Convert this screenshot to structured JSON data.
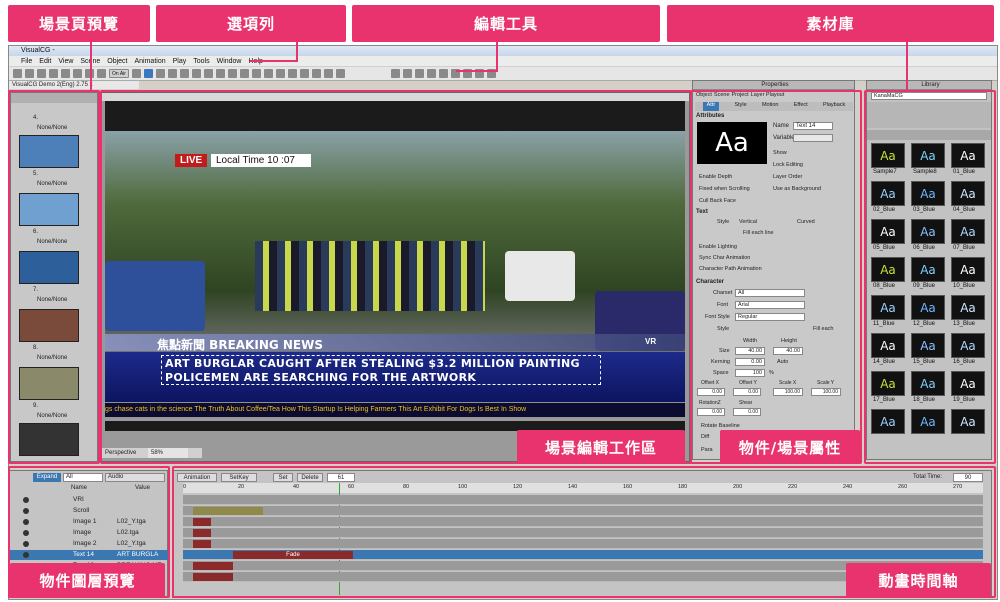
{
  "window": {
    "title": "VisualCG -",
    "doc_tab": "VisualCG Demo 2(Eng) 2.75 x"
  },
  "menu": [
    "File",
    "Edit",
    "View",
    "Scene",
    "Object",
    "Animation",
    "Play",
    "Tools",
    "Window",
    "Help"
  ],
  "callouts": {
    "scene_preview": "場景頁預覽",
    "menubar": "選項列",
    "edit_tools": "編輯工具",
    "library": "素材庫",
    "workspace": "場景編輯工作區",
    "properties": "物件/場景屬性",
    "layers": "物件圖層預覽",
    "timeline": "動畫時間軸"
  },
  "toolbar": {
    "zoom_label": "On Air"
  },
  "scene_list": [
    {
      "num": "4.",
      "caption": "None/None"
    },
    {
      "num": "5.",
      "caption": "None/None"
    },
    {
      "num": "6.",
      "caption": "None/None"
    },
    {
      "num": "7.",
      "caption": "None/None"
    },
    {
      "num": "8.",
      "caption": "None/None"
    },
    {
      "num": "9.",
      "caption": "None/None"
    }
  ],
  "stage": {
    "live": "LIVE",
    "local_time": "Local Time 10 :07",
    "news_title": "焦點新聞 BREAKING NEWS",
    "headline1": "ART BURGLAR CAUGHT AFTER STEALING $3.2 MILLION PAINTING",
    "headline2": "POLICEMEN ARE SEARCHING FOR THE ARTWORK",
    "ticker": "gs chase cats in the science   The Truth About Coffee/Tea   How This Startup Is Helping Farmers   This Art Exhibit For Dogs Is Best In Show",
    "view_mode": "Perspective",
    "zoom": "58%",
    "vr": "VR"
  },
  "properties": {
    "title": "Properties",
    "tabs": [
      "Object",
      "Scene",
      "Project",
      "Layer Playout"
    ],
    "subtabs": [
      "Attr",
      "Style",
      "Motion",
      "Effect",
      "Playback"
    ],
    "section_attributes": "Attributes",
    "preview": "Aa",
    "name_label": "Name",
    "name_value": "Text 14",
    "variable_label": "Variable",
    "checks_right": [
      "Show",
      "Lock Editing",
      "Layer Order",
      "Use as Background"
    ],
    "checks_left": [
      "Enable Depth",
      "Fixed when Scrolling",
      "Cull Back Face"
    ],
    "section_text": "Text",
    "style_label": "Style",
    "vertical": "Vertical",
    "curved": "Curved",
    "fill": "Fill each line",
    "enable_lighting": "Enable Lighting",
    "sync_char": "Sync Char Animation",
    "char_path": "Character Path Animation",
    "section_character": "Character",
    "charset_label": "Charset",
    "charset_value": "All",
    "font_label": "Font",
    "font_value": "Arial",
    "font_style_label": "Font Style",
    "font_style_value": "Regular",
    "style2_label": "Style",
    "fill_each": "Fill each",
    "width_label": "Width",
    "height_label": "Height",
    "size_label": "Size",
    "size_w": "40.00",
    "size_h": "40.00",
    "kerning_label": "Kerning",
    "kerning": "0.00",
    "auto": "Auto",
    "space_label": "Space",
    "space": "100",
    "pct": "%",
    "offx_label": "Offset X",
    "offy_label": "Offset Y",
    "scx_label": "Scale X",
    "scy_label": "Scale Y",
    "offx": "0.00",
    "offy": "0.00",
    "scx": "100.00",
    "scy": "100.00",
    "rotz_label": "RotationZ",
    "shear_label": "Shear",
    "rotz": "0.00",
    "shear": "0.00",
    "rotate_baseline": "Rotate Baseline",
    "diff": "Diff",
    "para": "Para"
  },
  "library": {
    "title": "Library",
    "dropdown": "KanaMaCG",
    "items": [
      {
        "label": "Sample7",
        "tx": "Aa"
      },
      {
        "label": "Sample8",
        "tx": "Aa"
      },
      {
        "label": "01_Blue",
        "tx": "Aa"
      },
      {
        "label": "02_Blue",
        "tx": "Aa"
      },
      {
        "label": "03_Blue",
        "tx": "Aa"
      },
      {
        "label": "04_Blue",
        "tx": "Aa"
      },
      {
        "label": "05_Blue",
        "tx": "Aa"
      },
      {
        "label": "06_Blue",
        "tx": "Aa"
      },
      {
        "label": "07_Blue",
        "tx": "Aa"
      },
      {
        "label": "08_Blue",
        "tx": "Aa"
      },
      {
        "label": "09_Blue",
        "tx": "Aa"
      },
      {
        "label": "10_Blue",
        "tx": "Aa"
      },
      {
        "label": "11_Blue",
        "tx": "Aa"
      },
      {
        "label": "12_Blue",
        "tx": "Aa"
      },
      {
        "label": "13_Blue",
        "tx": "Aa"
      },
      {
        "label": "14_Blue",
        "tx": "Aa"
      },
      {
        "label": "15_Blue",
        "tx": "Aa"
      },
      {
        "label": "16_Blue",
        "tx": "Aa"
      },
      {
        "label": "17_Blue",
        "tx": "Aa"
      },
      {
        "label": "18_Blue",
        "tx": "Aa"
      },
      {
        "label": "19_Blue",
        "tx": "Aa"
      },
      {
        "label": "",
        "tx": "Aa"
      },
      {
        "label": "",
        "tx": "Aa"
      },
      {
        "label": "",
        "tx": "Aa"
      }
    ]
  },
  "layers": {
    "expand": "Expand",
    "filter": "All",
    "audio": "Audio",
    "col_name": "Name",
    "col_value": "Value",
    "rows": [
      {
        "name": "VRI",
        "value": ""
      },
      {
        "name": "Scroll",
        "value": ""
      },
      {
        "name": "Image 1",
        "value": "L02_Y.tga"
      },
      {
        "name": "Image",
        "value": "L02.tga"
      },
      {
        "name": "Image 2",
        "value": "L02_Y.tga"
      },
      {
        "name": "Text 14",
        "value": "ART BURGLA"
      },
      {
        "name": "Text 13",
        "value": "BREAKING NE"
      }
    ]
  },
  "timeline": {
    "animation": "Animation",
    "setkey": "SetKey",
    "set": "Set",
    "delete": "Delete",
    "frame": "61",
    "total_time_label": "Total Time:",
    "total_time": "90",
    "ruler": [
      "0",
      "20",
      "40",
      "60",
      "80",
      "100",
      "120",
      "140",
      "160",
      "180",
      "200",
      "220",
      "240",
      "260",
      "270"
    ],
    "fade": "Fade"
  }
}
